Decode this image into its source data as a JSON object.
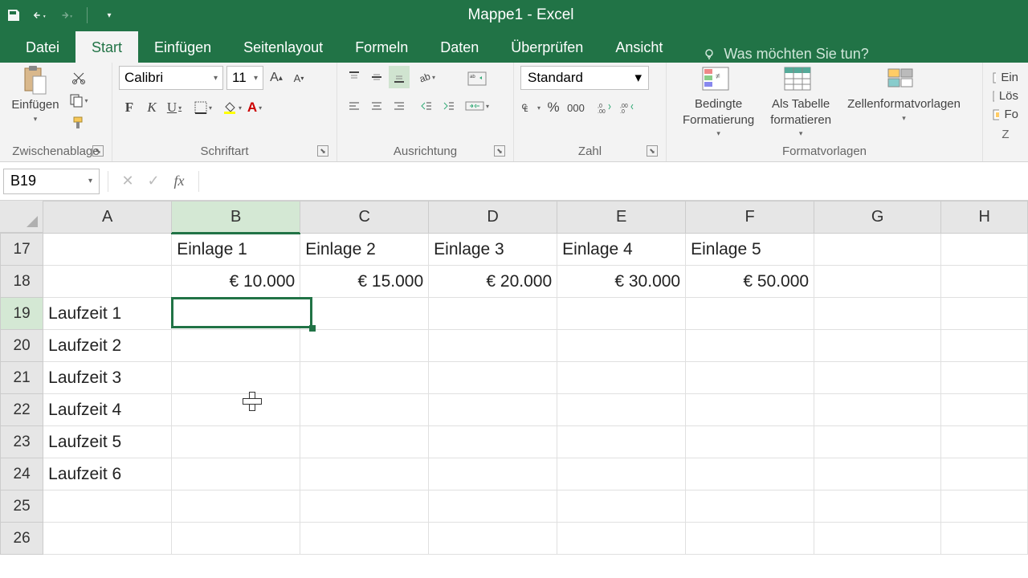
{
  "app": {
    "title": "Mappe1 - Excel"
  },
  "tabs": {
    "datei": "Datei",
    "start": "Start",
    "einfuegen": "Einfügen",
    "seitenlayout": "Seitenlayout",
    "formeln": "Formeln",
    "daten": "Daten",
    "ueberpruefen": "Überprüfen",
    "ansicht": "Ansicht",
    "tellme": "Was möchten Sie tun?"
  },
  "ribbon": {
    "clipboard": {
      "paste": "Einfügen",
      "group": "Zwischenablage"
    },
    "font": {
      "name": "Calibri",
      "size": "11",
      "group": "Schriftart"
    },
    "alignment": {
      "group": "Ausrichtung"
    },
    "number": {
      "format": "Standard",
      "group": "Zahl"
    },
    "styles": {
      "conditional": "Bedingte\nFormatierung",
      "table": "Als Tabelle\nformatieren",
      "cellstyles": "Zellenformatvorlagen",
      "group": "Formatvorlagen"
    },
    "edge": {
      "insert": "Ein",
      "delete": "Lös",
      "format": "Fo"
    }
  },
  "fbar": {
    "name": "B19",
    "formula": ""
  },
  "grid": {
    "cols": [
      "A",
      "B",
      "C",
      "D",
      "E",
      "F",
      "G",
      "H"
    ],
    "rows": [
      "17",
      "18",
      "19",
      "20",
      "21",
      "22",
      "23",
      "24",
      "25",
      "26"
    ],
    "activeCol": 1,
    "activeRow": 2,
    "cells": {
      "r17": {
        "B": "Einlage 1",
        "C": "Einlage 2",
        "D": "Einlage 3",
        "E": "Einlage 4",
        "F": "Einlage 5"
      },
      "r18": {
        "B": "€ 10.000",
        "C": "€ 15.000",
        "D": "€ 20.000",
        "E": "€ 30.000",
        "F": "€ 50.000"
      },
      "r19": {
        "A": "Laufzeit 1"
      },
      "r20": {
        "A": "Laufzeit 2"
      },
      "r21": {
        "A": "Laufzeit 3"
      },
      "r22": {
        "A": "Laufzeit 4"
      },
      "r23": {
        "A": "Laufzeit 5"
      },
      "r24": {
        "A": "Laufzeit 6"
      }
    }
  }
}
